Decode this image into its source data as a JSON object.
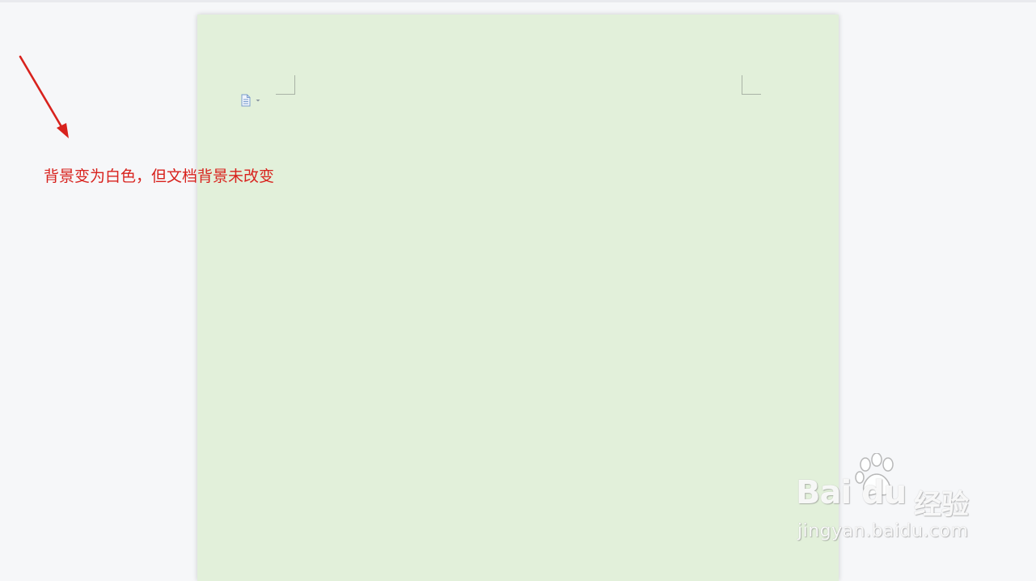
{
  "annotation": {
    "text": "背景变为白色，但文档背景未改变",
    "color": "#d8221d"
  },
  "document": {
    "background_color": "#e2f0da",
    "tool_icon": "document-icon"
  },
  "watermark": {
    "brand": "Bai du",
    "brand_cn": "经验",
    "url": "jingyan.baidu.com"
  },
  "colors": {
    "canvas": "#f6f7f9",
    "arrow": "#d8221d"
  }
}
